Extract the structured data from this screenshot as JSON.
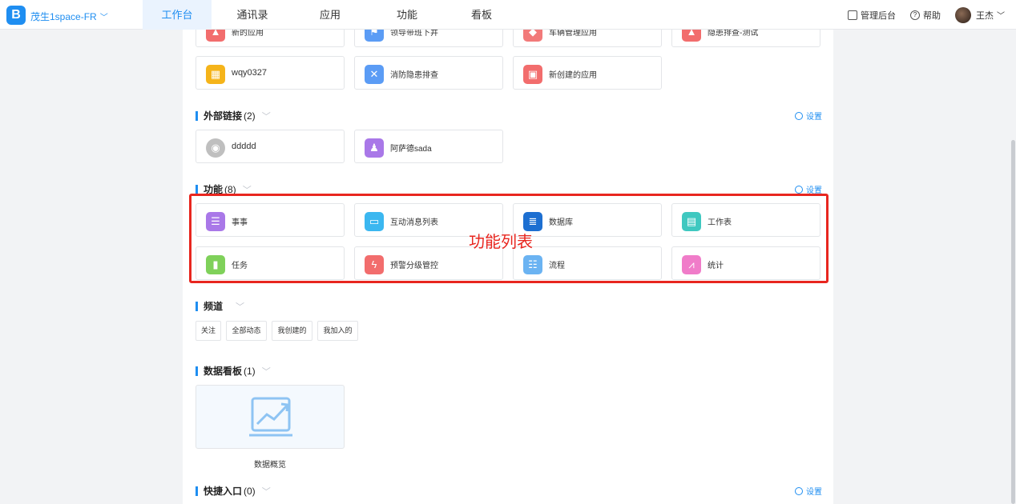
{
  "header": {
    "org_name": "茂生1space-FR",
    "nav": [
      "工作台",
      "通讯录",
      "应用",
      "功能",
      "看板"
    ],
    "admin_label": "管理后台",
    "help_label": "帮助",
    "user_name": "王杰"
  },
  "apps_partial": [
    "新的应用",
    "领导带班下井",
    "车辆管理应用",
    "隐患排查-测试"
  ],
  "apps": [
    "wqy0327",
    "消防隐患排查",
    "新创建的应用"
  ],
  "external_links": {
    "title": "外部链接",
    "count": "(2)",
    "settings": "设置",
    "items": [
      "ddddd",
      "阿萨德sada"
    ]
  },
  "features": {
    "title": "功能",
    "count": "(8)",
    "settings": "设置",
    "items": [
      "事事",
      "互动消息列表",
      "数据库",
      "工作表",
      "任务",
      "预警分级管控",
      "流程",
      "统计"
    ]
  },
  "channels": {
    "title": "频道",
    "chips": [
      "关注",
      "全部动态",
      "我创建的",
      "我加入的"
    ]
  },
  "dashboards": {
    "title": "数据看板",
    "count": "(1)",
    "items": [
      "数据概览"
    ]
  },
  "shortcuts": {
    "title": "快捷入口",
    "count": "(0)",
    "settings": "设置"
  },
  "annotation": "功能列表",
  "colors": {
    "accent": "#1f8ef1",
    "highlight": "#e8261f"
  }
}
